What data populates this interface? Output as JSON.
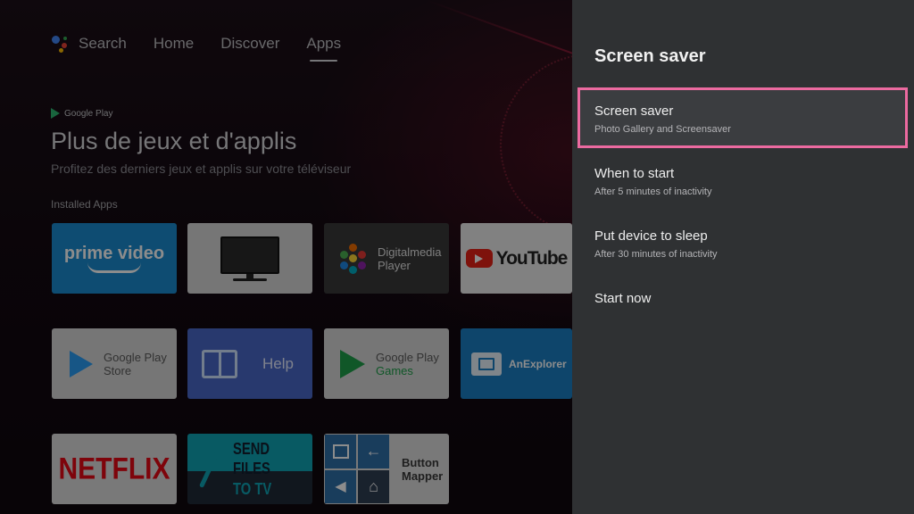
{
  "nav": {
    "items": [
      {
        "label": "Search"
      },
      {
        "label": "Home"
      },
      {
        "label": "Discover"
      },
      {
        "label": "Apps",
        "active": true
      }
    ]
  },
  "promo": {
    "badge": "Google Play",
    "title": "Plus de jeux et d'applis",
    "subtitle": "Profitez des derniers jeux et applis sur votre téléviseur"
  },
  "installed": {
    "header": "Installed Apps",
    "apps": {
      "prime": {
        "label": "prime video"
      },
      "tv": {
        "label": ""
      },
      "digital": {
        "line1": "Digitalmedia",
        "line2": "Player"
      },
      "youtube": {
        "label": "YouTube"
      },
      "playstore": {
        "line1": "Google Play",
        "line2": "Store"
      },
      "help": {
        "label": "Help"
      },
      "games": {
        "line1": "Google Play",
        "line2": "Games"
      },
      "anexplorer": {
        "label": "AnExplorer"
      },
      "netflix": {
        "label": "NETFLIX"
      },
      "sendfiles": {
        "line1": "SEND FILES",
        "line2": "TO TV"
      },
      "mapper": {
        "line1": "Button",
        "line2": "Mapper"
      }
    }
  },
  "panel": {
    "title": "Screen saver",
    "options": [
      {
        "title": "Screen saver",
        "subtitle": "Photo Gallery and Screensaver",
        "focused": true
      },
      {
        "title": "When to start",
        "subtitle": "After 5 minutes of inactivity"
      },
      {
        "title": "Put device to sleep",
        "subtitle": "After 30 minutes of inactivity"
      },
      {
        "title": "Start now",
        "subtitle": ""
      }
    ]
  },
  "colors": {
    "focus_border": "#ec6aa0",
    "panel_bg": "#2f3133",
    "prime_blue": "#1b8ad0",
    "netflix_red": "#e50914",
    "help_blue": "#4a68c8",
    "sendfiles_teal": "#0fa4b4"
  }
}
